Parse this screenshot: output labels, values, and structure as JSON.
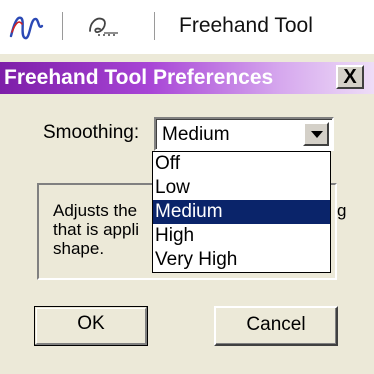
{
  "toolbar": {
    "freehand_icon": "freehand-wave-icon",
    "pen_icon": "pen-curve-icon",
    "title": "Freehand Tool",
    "icon_color": "#2b49b5"
  },
  "dialog": {
    "title": "Freehand Tool Preferences",
    "close_label": "X",
    "title_gradient_start": "#7d1ea8",
    "title_gradient_end": "#eeddf7"
  },
  "smoothing": {
    "label": "Smoothing:",
    "selected_value": "Medium",
    "options": [
      "Off",
      "Low",
      "Medium",
      "High",
      "Very High"
    ]
  },
  "info": {
    "line1": "Adjusts the",
    "line1_tail": "g",
    "line2": "that is appli",
    "line3": "shape."
  },
  "buttons": {
    "ok": "OK",
    "cancel": "Cancel"
  },
  "colors": {
    "dialog_bg": "#ece9d8",
    "selection_bg": "#0a246a",
    "selection_text": "#ffffff"
  }
}
